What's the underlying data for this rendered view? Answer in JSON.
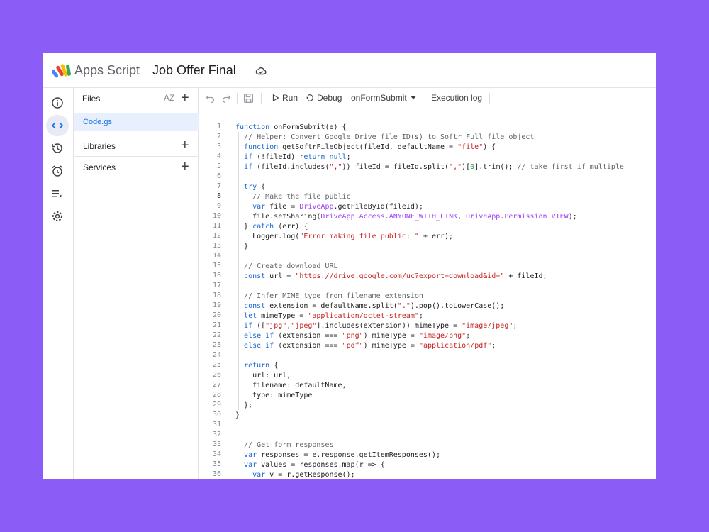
{
  "app": {
    "name": "Apps Script",
    "project_title": "Job Offer Final"
  },
  "files_panel": {
    "title": "Files",
    "sort_label": "AZ",
    "files": [
      {
        "name": "Code.gs",
        "selected": true
      }
    ],
    "sections": [
      {
        "label": "Libraries"
      },
      {
        "label": "Services"
      }
    ]
  },
  "toolbar": {
    "run_label": "Run",
    "debug_label": "Debug",
    "function_select": "onFormSubmit",
    "execution_log_label": "Execution log"
  },
  "editor": {
    "line_numbers": [
      "1",
      "2",
      "3",
      "4",
      "5",
      "6",
      "7",
      "8",
      "9",
      "10",
      "11",
      "12",
      "13",
      "14",
      "15",
      "16",
      "17",
      "18",
      "19",
      "20",
      "21",
      "22",
      "23",
      "24",
      "25",
      "26",
      "27",
      "28",
      "29",
      "30",
      "31",
      "32",
      "33",
      "34",
      "35",
      "36"
    ],
    "current_line": 8,
    "lines": [
      "function onFormSubmit(e) {",
      "  // Helper: Convert Google Drive file ID(s) to Softr Full file object",
      "  function getSoftrFileObject(fileId, defaultName = \"file\") {",
      "  if (!fileId) return null;",
      "  if (fileId.includes(\",\")) fileId = fileId.split(\",\")[0].trim(); // take first if multiple",
      "",
      "  try {",
      "    // Make the file public",
      "    var file = DriveApp.getFileById(fileId);",
      "    file.setSharing(DriveApp.Access.ANYONE_WITH_LINK, DriveApp.Permission.VIEW);",
      "  } catch (err) {",
      "    Logger.log(\"Error making file public: \" + err);",
      "  }",
      "",
      "  // Create download URL",
      "  const url = \"https://drive.google.com/uc?export=download&id=\" + fileId;",
      "",
      "  // Infer MIME type from filename extension",
      "  const extension = defaultName.split(\".\").pop().toLowerCase();",
      "  let mimeType = \"application/octet-stream\";",
      "  if ([\"jpg\",\"jpeg\"].includes(extension)) mimeType = \"image/jpeg\";",
      "  else if (extension === \"png\") mimeType = \"image/png\";",
      "  else if (extension === \"pdf\") mimeType = \"application/pdf\";",
      "",
      "  return {",
      "    url: url,",
      "    filename: defaultName,",
      "    type: mimeType",
      "  };",
      "}",
      "",
      "",
      "  // Get form responses",
      "  var responses = e.response.getItemResponses();",
      "  var values = responses.map(r => {",
      "    var v = r.getResponse();"
    ]
  },
  "colors": {
    "background": "#8b5cf6",
    "keyword": "#1967d2",
    "string": "#c5221f",
    "comment": "#5f6368",
    "object": "#a142f4",
    "selected_file": "#e8f0fe"
  },
  "icons": [
    "info-icon",
    "code-icon",
    "history-icon",
    "alarm-icon",
    "executions-icon",
    "settings-icon",
    "cloud-icon",
    "undo-icon",
    "redo-icon",
    "save-icon",
    "run-icon",
    "debug-icon",
    "dropdown-icon"
  ]
}
